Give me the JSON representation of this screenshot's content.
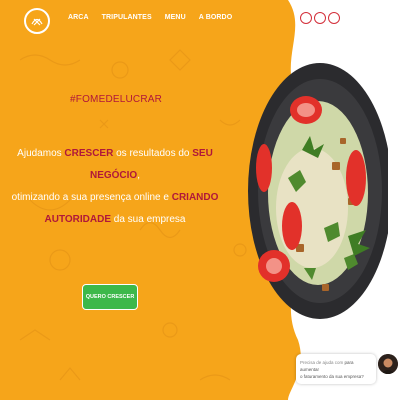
{
  "nav": {
    "items": [
      {
        "label": "ARCA"
      },
      {
        "label": "TRIPULANTES"
      },
      {
        "label": "MENU"
      },
      {
        "label": "A BORDO"
      }
    ]
  },
  "hero": {
    "hashtag": "#FOMEDELUCRAR",
    "line1_a": "Ajudamos ",
    "line1_b": "CRESCER",
    "line1_c": " os resultados do ",
    "line1_d": "SEU NEGÓCIO",
    "line1_e": ",",
    "line2_a": "otimizando a sua presença online e ",
    "line2_b": "CRIANDO",
    "line3_a": "AUTORIDADE",
    "line3_b": " da sua empresa",
    "cta_label": "QUERO CRESCER"
  },
  "chat": {
    "text_a": "Precisa de ajuda com ",
    "text_b": "para aumentar",
    "text_c": "o faturamento da sua empresa?"
  },
  "colors": {
    "background": "#f6a51a",
    "accent": "#b0183a",
    "cta": "#3db84a",
    "circles": "#d32f3a"
  },
  "icons": [
    "logo-icon",
    "circle-icons"
  ]
}
